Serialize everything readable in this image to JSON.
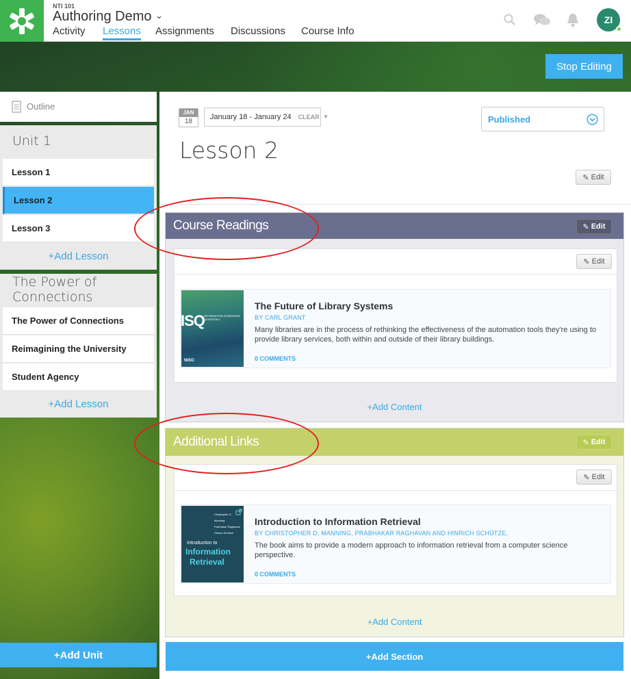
{
  "header": {
    "course_code": "NTI 101",
    "course_title": "Authoring Demo",
    "tabs": [
      "Activity",
      "Lessons",
      "Assignments",
      "Discussions",
      "Course Info"
    ],
    "active_tab": "Lessons",
    "avatar_initials": "ZI",
    "icons": [
      "search-icon",
      "chat-icon",
      "bell-icon"
    ]
  },
  "stop_editing_label": "Stop Editing",
  "sidebar": {
    "outline_label": "Outline",
    "units": [
      {
        "title": "Unit 1",
        "lessons": [
          "Lesson 1",
          "Lesson 2",
          "Lesson 3"
        ],
        "add_lesson": "+Add Lesson"
      },
      {
        "title": "The Power of Connections",
        "lessons": [
          "The Power of Connections",
          "Reimagining the University",
          "Student Agency"
        ],
        "add_lesson": "+Add Lesson"
      }
    ],
    "selected_lesson": "Lesson 2",
    "add_unit": "+Add Unit"
  },
  "lesson": {
    "date_badge": {
      "month": "JAN",
      "day": "18"
    },
    "date_range": "January 18 - January 24",
    "clear_label": "CLEAR",
    "status": "Published",
    "title": "Lesson 2",
    "edit_label": "Edit"
  },
  "sections": [
    {
      "title": "Course Readings",
      "color": "#6b6f8f",
      "edit_label": "Edit",
      "card_edit_label": "Edit",
      "item": {
        "title": "The Future of Library Systems",
        "author": "BY CARL GRANT",
        "description": "Many libraries are in the process of rethinking the effectiveness of the automation tools they're using to provide library services, both within and outside of their library buildings.",
        "comments": "0 COMMENTS",
        "thumb_text": "ISQ",
        "thumb_sub": "INFORMATION STANDARDS QUARTERLY",
        "thumb_footer": "NISO"
      },
      "add_content": "+Add Content"
    },
    {
      "title": "Additional Links",
      "color": "#c3d16a",
      "edit_label": "Edit",
      "card_edit_label": "Edit",
      "item": {
        "title": "Introduction to Information Retrieval",
        "author": "BY CHRISTOPHER D. MANNING, PRABHAKAR RAGHAVAN AND HINRICH SCHÜTZE,",
        "description": "The book aims to provide a modern approach to information retrieval from a computer science perspective.",
        "comments": "0 COMMENTS",
        "thumb_line1": "Introduction to",
        "thumb_line2": "Information",
        "thumb_line3": "Retrieval",
        "thumb_authors": [
          "Christopher D. Manning",
          "Prabhakar Raghavan",
          "Hinrich Schütze"
        ]
      },
      "add_content": "+Add Content"
    }
  ],
  "add_section": "+Add Section"
}
